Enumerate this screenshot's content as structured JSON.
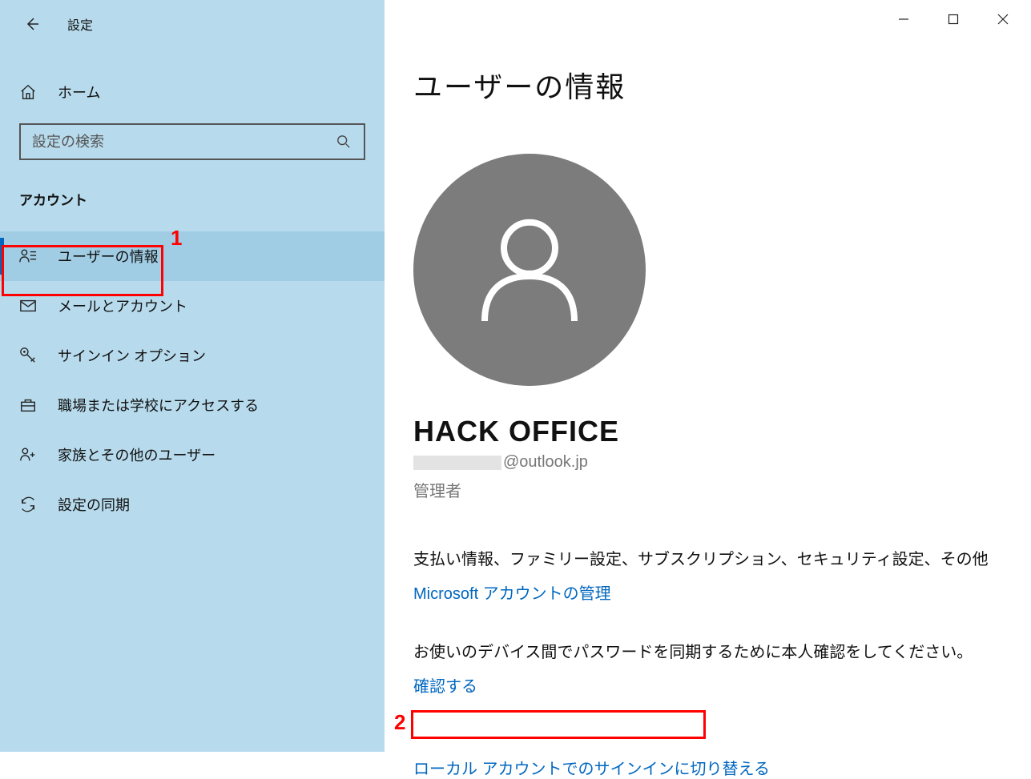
{
  "window": {
    "title": "設定"
  },
  "sidebar": {
    "home_label": "ホーム",
    "search_placeholder": "設定の検索",
    "section_label": "アカウント",
    "items": [
      {
        "label": "ユーザーの情報",
        "icon": "user-detail-icon",
        "selected": true
      },
      {
        "label": "メールとアカウント",
        "icon": "mail-icon",
        "selected": false
      },
      {
        "label": "サインイン オプション",
        "icon": "key-icon",
        "selected": false
      },
      {
        "label": "職場または学校にアクセスする",
        "icon": "briefcase-icon",
        "selected": false
      },
      {
        "label": "家族とその他のユーザー",
        "icon": "family-icon",
        "selected": false
      },
      {
        "label": "設定の同期",
        "icon": "sync-icon",
        "selected": false
      }
    ]
  },
  "content": {
    "page_title": "ユーザーの情報",
    "user_name": "HACK OFFICE",
    "user_email_suffix": "@outlook.jp",
    "user_role": "管理者",
    "account_info_text": "支払い情報、ファミリー設定、サブスクリプション、セキュリティ設定、その他",
    "manage_link": "Microsoft アカウントの管理",
    "verify_text": "お使いのデバイス間でパスワードを同期するために本人確認をしてください。",
    "verify_link": "確認する",
    "local_account_link": "ローカル アカウントでのサインインに切り替える"
  },
  "annotations": {
    "one": "1",
    "two": "2"
  }
}
